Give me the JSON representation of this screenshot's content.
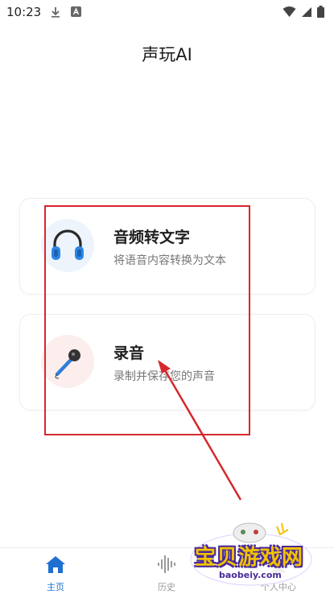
{
  "status_bar": {
    "time": "10:23"
  },
  "header": {
    "title": "声玩AI"
  },
  "cards": [
    {
      "title": "音频转文字",
      "subtitle": "将语音内容转换为文本",
      "icon": "headphones-icon"
    },
    {
      "title": "录音",
      "subtitle": "录制并保存您的声音",
      "icon": "microphone-icon"
    }
  ],
  "bottom_nav": {
    "items": [
      {
        "label": "主页",
        "icon": "home-icon",
        "active": true
      },
      {
        "label": "历史",
        "icon": "waveform-icon",
        "active": false
      },
      {
        "label": "个人中心",
        "icon": "person-icon",
        "active": false
      }
    ]
  },
  "watermark": {
    "text": "宝贝游戏网",
    "url": "baobeiy.com"
  },
  "colors": {
    "accent": "#1f6fd0",
    "inactive": "#9a9a9a",
    "annotation_red": "#d6282c"
  }
}
